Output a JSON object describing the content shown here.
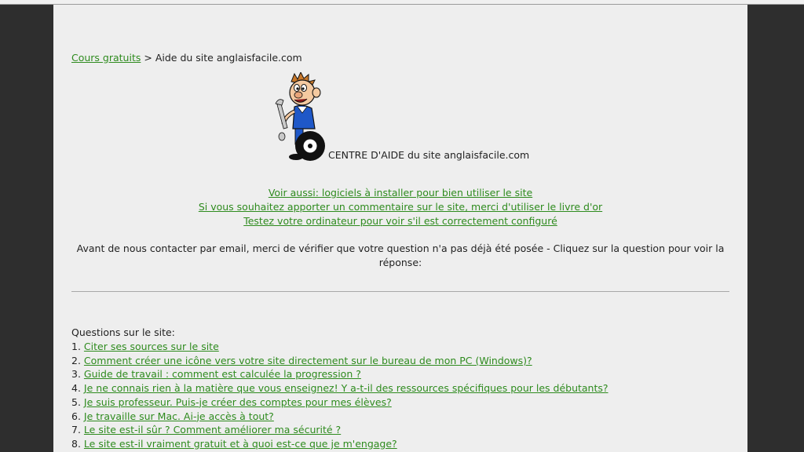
{
  "breadcrumb": {
    "link": "Cours gratuits",
    "separator": ">",
    "current": "Aide du site anglaisfacile.com"
  },
  "help": {
    "title": "CENTRE D'AIDE du site anglaisfacile.com"
  },
  "links": [
    "Voir aussi: logiciels à installer pour bien utiliser le site",
    "Si vous souhaitez apporter un commentaire sur le site, merci d'utiliser le livre d'or",
    "Testez votre ordinateur pour voir s'il est correctement configuré"
  ],
  "notice": "Avant de nous contacter par email, merci de vérifier que votre question n'a pas déjà été posée - Cliquez sur la question pour voir la réponse:",
  "questions": {
    "heading": "Questions sur le site:",
    "items": [
      {
        "num": "1.",
        "text": "Citer ses sources sur le site"
      },
      {
        "num": "2.",
        "text": "Comment créer une icône vers votre site directement sur le bureau de mon PC (Windows)?"
      },
      {
        "num": "3.",
        "text": "Guide de travail : comment est calculée la progression ?"
      },
      {
        "num": "4.",
        "text": "Je ne connais rien à la matière que vous enseignez! Y a-t-il des ressources spécifiques pour les débutants?"
      },
      {
        "num": "5.",
        "text": "Je suis professeur. Puis-je créer des comptes pour mes élèves?"
      },
      {
        "num": "6.",
        "text": "Je travaille sur Mac. Ai-je accès à tout?"
      },
      {
        "num": "7.",
        "text": "Le site est-il sûr ? Comment améliorer ma sécurité ?"
      },
      {
        "num": "8.",
        "text": "Le site est-il vraiment gratuit et à quoi est-ce que je m'engage?"
      }
    ]
  }
}
